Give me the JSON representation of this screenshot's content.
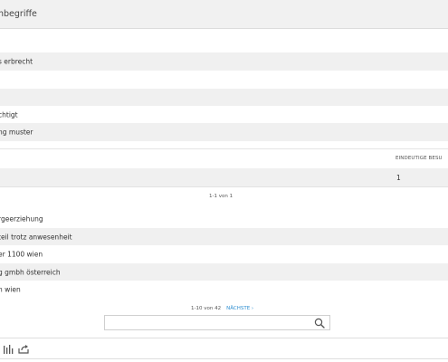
{
  "header": {
    "title": "hbegriffe"
  },
  "top_list": {
    "items": [
      "s erbrecht",
      "",
      "",
      "chtigt",
      "ng muster"
    ]
  },
  "table": {
    "column_header": "EINDEUTIGE BESU",
    "value": "1",
    "pager": "1-1 von 1"
  },
  "bottom_list": {
    "items": [
      "rgeerziehung",
      "teil trotz anwesenheit",
      "er 1100 wien",
      "g gmbh österreich",
      "n wien"
    ],
    "pager": "1-10 von 42",
    "next_label": "NÄCHSTE ›"
  },
  "search": {
    "placeholder": "",
    "value": ""
  },
  "footer": {
    "icons": [
      "bar-chart-icon",
      "share-icon"
    ]
  },
  "colors": {
    "accent": "#2f8fd1",
    "row_shade": "#f0f0f0",
    "header_bg": "#f1f1f1"
  }
}
